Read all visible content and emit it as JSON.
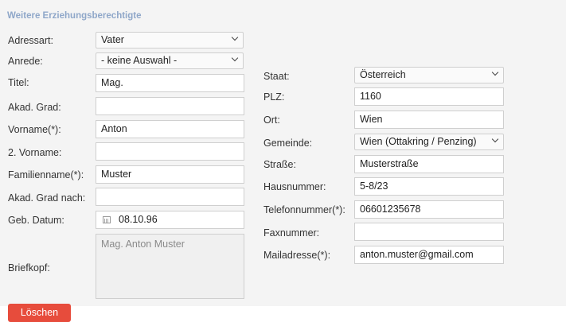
{
  "section": {
    "title": "Weitere Erziehungsberechtigte"
  },
  "left": {
    "adressart": {
      "label": "Adressart:",
      "value": "Vater"
    },
    "anrede": {
      "label": "Anrede:",
      "value": "- keine Auswahl -"
    },
    "titel": {
      "label": "Titel:",
      "value": "Mag."
    },
    "akad_grad": {
      "label": "Akad. Grad:",
      "value": ""
    },
    "vorname": {
      "label": "Vorname(*):",
      "value": "Anton"
    },
    "vorname2": {
      "label": "2. Vorname:",
      "value": ""
    },
    "familienname": {
      "label": "Familienname(*):",
      "value": "Muster"
    },
    "akad_grad_nach": {
      "label": "Akad. Grad nach:",
      "value": ""
    },
    "geb_datum": {
      "label": "Geb. Datum:",
      "value": "08.10.96"
    },
    "briefkopf": {
      "label": "Briefkopf:",
      "value": "Mag. Anton Muster"
    }
  },
  "right": {
    "staat": {
      "label": "Staat:",
      "value": "Österreich"
    },
    "plz": {
      "label": "PLZ:",
      "value": "1160"
    },
    "ort": {
      "label": "Ort:",
      "value": "Wien"
    },
    "gemeinde": {
      "label": "Gemeinde:",
      "value": "Wien (Ottakring / Penzing)"
    },
    "strasse": {
      "label": "Straße:",
      "value": "Musterstraße"
    },
    "hausnummer": {
      "label": "Hausnummer:",
      "value": "5-8/23"
    },
    "telefonnummer": {
      "label": "Telefonnummer(*):",
      "value": "06601235678"
    },
    "faxnummer": {
      "label": "Faxnummer:",
      "value": ""
    },
    "mailadresse": {
      "label": "Mailadresse(*):",
      "value": "anton.muster@gmail.com"
    }
  },
  "actions": {
    "delete_label": "Löschen"
  },
  "colors": {
    "accent_title": "#8fa7c9",
    "delete_button": "#e74c3c",
    "panel_bg": "#f4f4f4"
  },
  "icons": {
    "select_arrow": "chevron-down-icon",
    "date_picker": "calendar-icon"
  }
}
